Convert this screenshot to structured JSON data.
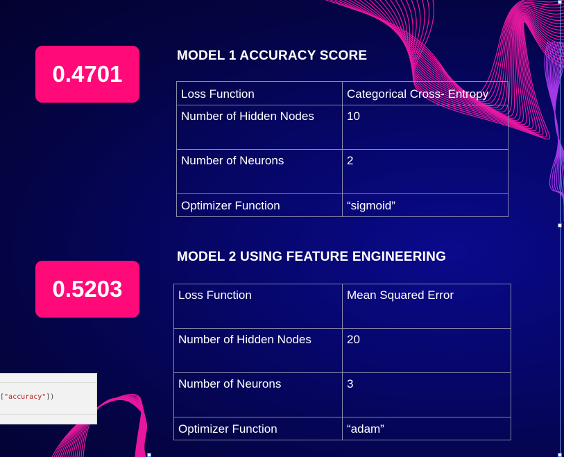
{
  "model1": {
    "score": "0.4701",
    "title": "MODEL 1 ACCURACY SCORE",
    "rows": [
      {
        "param": "Loss Function",
        "value": "Categorical Cross- Entropy"
      },
      {
        "param": "Number of Hidden Nodes",
        "value": "10"
      },
      {
        "param": "Number of Neurons",
        "value": "2"
      },
      {
        "param": "Optimizer Function",
        "value": "“sigmoid”"
      }
    ]
  },
  "model2": {
    "score": "0.5203",
    "title": "MODEL 2 USING FEATURE ENGINEERING",
    "rows": [
      {
        "param": "Loss Function",
        "value": "Mean Squared Error"
      },
      {
        "param": "Number of Hidden Nodes",
        "value": "20"
      },
      {
        "param": "Number of Neurons",
        "value": "3"
      },
      {
        "param": "Optimizer Function",
        "value": "“adam”"
      }
    ]
  },
  "code_snippet": {
    "prefix": "[",
    "string": "\"accuracy\"",
    "suffix": "])"
  },
  "colors": {
    "badge": "#ff0a78",
    "background": "#06066a",
    "wave": "#ff1aa8"
  }
}
